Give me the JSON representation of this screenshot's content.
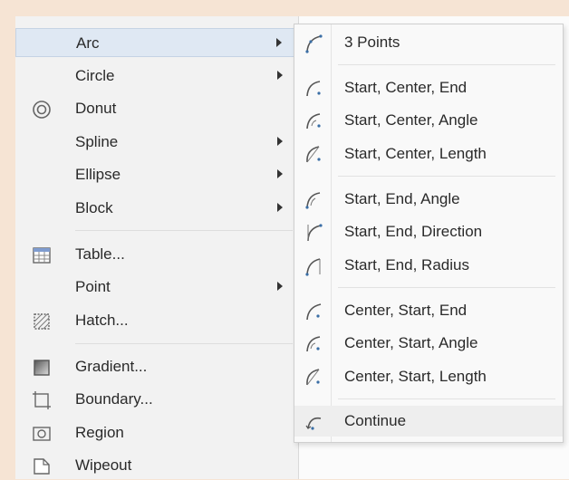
{
  "menu": {
    "items": [
      {
        "label": "Arc",
        "icon": "",
        "submenu": true,
        "active": true
      },
      {
        "label": "Circle",
        "icon": "",
        "submenu": true
      },
      {
        "label": "Donut",
        "icon": "donut-icon",
        "submenu": false
      },
      {
        "label": "Spline",
        "icon": "",
        "submenu": true
      },
      {
        "label": "Ellipse",
        "icon": "",
        "submenu": true
      },
      {
        "label": "Block",
        "icon": "",
        "submenu": true
      },
      {
        "label": "Table...",
        "icon": "table-icon",
        "submenu": false
      },
      {
        "label": "Point",
        "icon": "",
        "submenu": true
      },
      {
        "label": "Hatch...",
        "icon": "hatch-icon",
        "submenu": false
      },
      {
        "label": "Gradient...",
        "icon": "gradient-icon",
        "submenu": false
      },
      {
        "label": "Boundary...",
        "icon": "boundary-icon",
        "submenu": false
      },
      {
        "label": "Region",
        "icon": "region-icon",
        "submenu": false
      },
      {
        "label": "Wipeout",
        "icon": "wipeout-icon",
        "submenu": false
      }
    ]
  },
  "arc_submenu": {
    "items": [
      {
        "label": "3 Points",
        "icon": "arc-3-points-icon"
      },
      {
        "label": "Start, Center, End",
        "icon": "arc-start-center-end-icon"
      },
      {
        "label": "Start, Center, Angle",
        "icon": "arc-start-center-angle-icon"
      },
      {
        "label": "Start, Center, Length",
        "icon": "arc-start-center-length-icon"
      },
      {
        "label": "Start, End, Angle",
        "icon": "arc-start-end-angle-icon"
      },
      {
        "label": "Start, End, Direction",
        "icon": "arc-start-end-direction-icon"
      },
      {
        "label": "Start, End, Radius",
        "icon": "arc-start-end-radius-icon"
      },
      {
        "label": "Center, Start, End",
        "icon": "arc-center-start-end-icon"
      },
      {
        "label": "Center, Start, Angle",
        "icon": "arc-center-start-angle-icon"
      },
      {
        "label": "Center, Start, Length",
        "icon": "arc-center-start-length-icon"
      },
      {
        "label": "Continue",
        "icon": "arc-continue-icon",
        "hover": true
      }
    ]
  },
  "colors": {
    "background": "#f6e4d4",
    "menu": "#f2f2f2",
    "active": "#dfe8f3",
    "icon_stroke": "#555555",
    "icon_accent": "#3a6ea5"
  }
}
